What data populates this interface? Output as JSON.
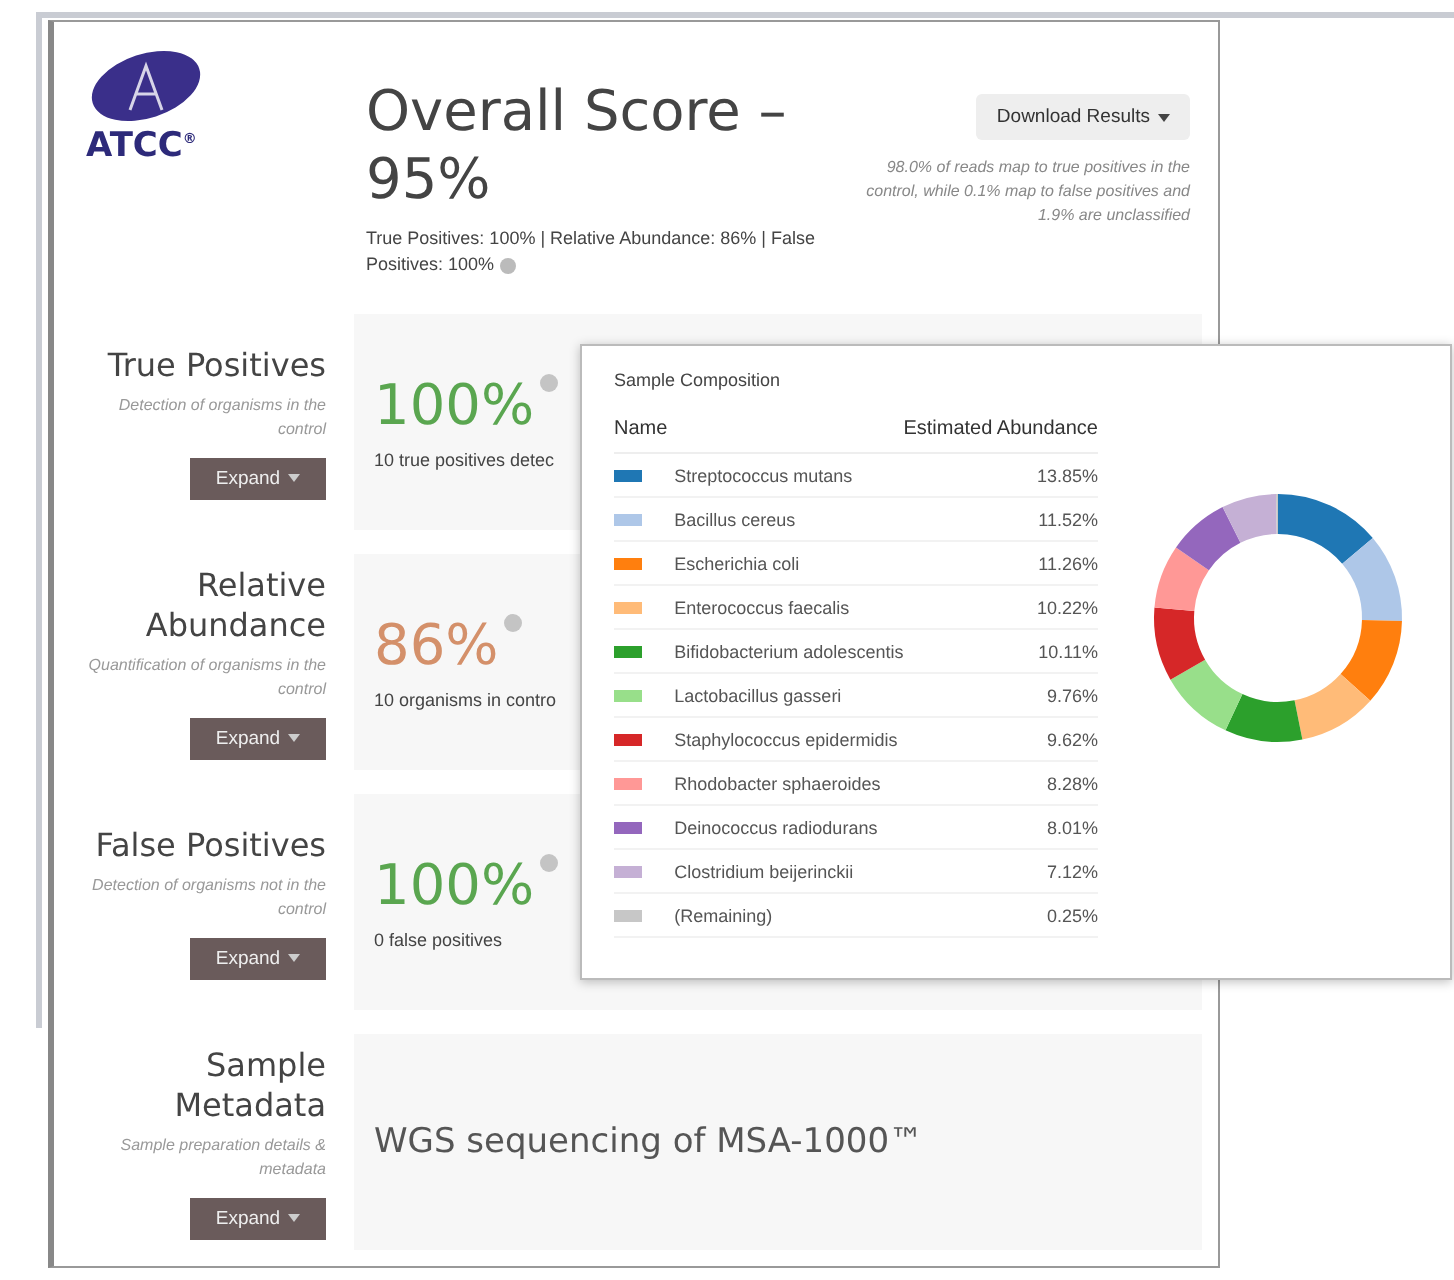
{
  "logo": {
    "text": "ATCC",
    "mark": "®"
  },
  "header": {
    "title": "Overall Score – 95%",
    "summary": "True Positives: 100% | Relative Abundance: 86% | False Positives: 100%",
    "download_button": "Download Results",
    "note": "98.0% of reads map to true positives in the control, while 0.1% map to false positives and 1.9% are unclassified"
  },
  "sections": [
    {
      "kind": "score",
      "title": "True Positives",
      "description": "Detection of organisms in the control",
      "button": "Expand",
      "score": "100%",
      "color": "#5aa650",
      "detail": "10 true positives detec"
    },
    {
      "kind": "score",
      "title": "Relative Abundance",
      "description": "Quantification of organisms in the control",
      "button": "Expand",
      "score": "86%",
      "color": "#d4906a",
      "detail": "10 organisms in contro"
    },
    {
      "kind": "score",
      "title": "False Positives",
      "description": "Detection of organisms not in the control",
      "button": "Expand",
      "score": "100%",
      "color": "#5aa650",
      "detail": "0 false positives"
    },
    {
      "kind": "text",
      "title": "Sample Metadata",
      "description": "Sample preparation details & metadata",
      "button": "Expand",
      "heading": "WGS sequencing of MSA-1000™"
    }
  ],
  "composition": {
    "title": "Sample Composition",
    "columns": [
      "Name",
      "Estimated Abundance"
    ],
    "rows": [
      {
        "name": "Streptococcus mutans",
        "abundance": "13.85%",
        "color": "#1f77b4"
      },
      {
        "name": "Bacillus cereus",
        "abundance": "11.52%",
        "color": "#aec7e8"
      },
      {
        "name": "Escherichia coli",
        "abundance": "11.26%",
        "color": "#ff7f0e"
      },
      {
        "name": "Enterococcus faecalis",
        "abundance": "10.22%",
        "color": "#ffbb78"
      },
      {
        "name": "Bifidobacterium adolescentis",
        "abundance": "10.11%",
        "color": "#2ca02c"
      },
      {
        "name": "Lactobacillus gasseri",
        "abundance": "9.76%",
        "color": "#98df8a"
      },
      {
        "name": "Staphylococcus epidermidis",
        "abundance": "9.62%",
        "color": "#d62728"
      },
      {
        "name": "Rhodobacter sphaeroides",
        "abundance": "8.28%",
        "color": "#ff9896"
      },
      {
        "name": "Deinococcus radiodurans",
        "abundance": "8.01%",
        "color": "#9467bd"
      },
      {
        "name": "Clostridium beijerinckii",
        "abundance": "7.12%",
        "color": "#c5b0d5"
      },
      {
        "name": "(Remaining)",
        "abundance": "0.25%",
        "color": "#c7c7c7"
      }
    ],
    "chart_data": {
      "type": "donut",
      "values": [
        13.85,
        11.52,
        11.26,
        10.22,
        10.11,
        9.76,
        9.62,
        8.28,
        8.01,
        7.12,
        0.25
      ]
    }
  }
}
